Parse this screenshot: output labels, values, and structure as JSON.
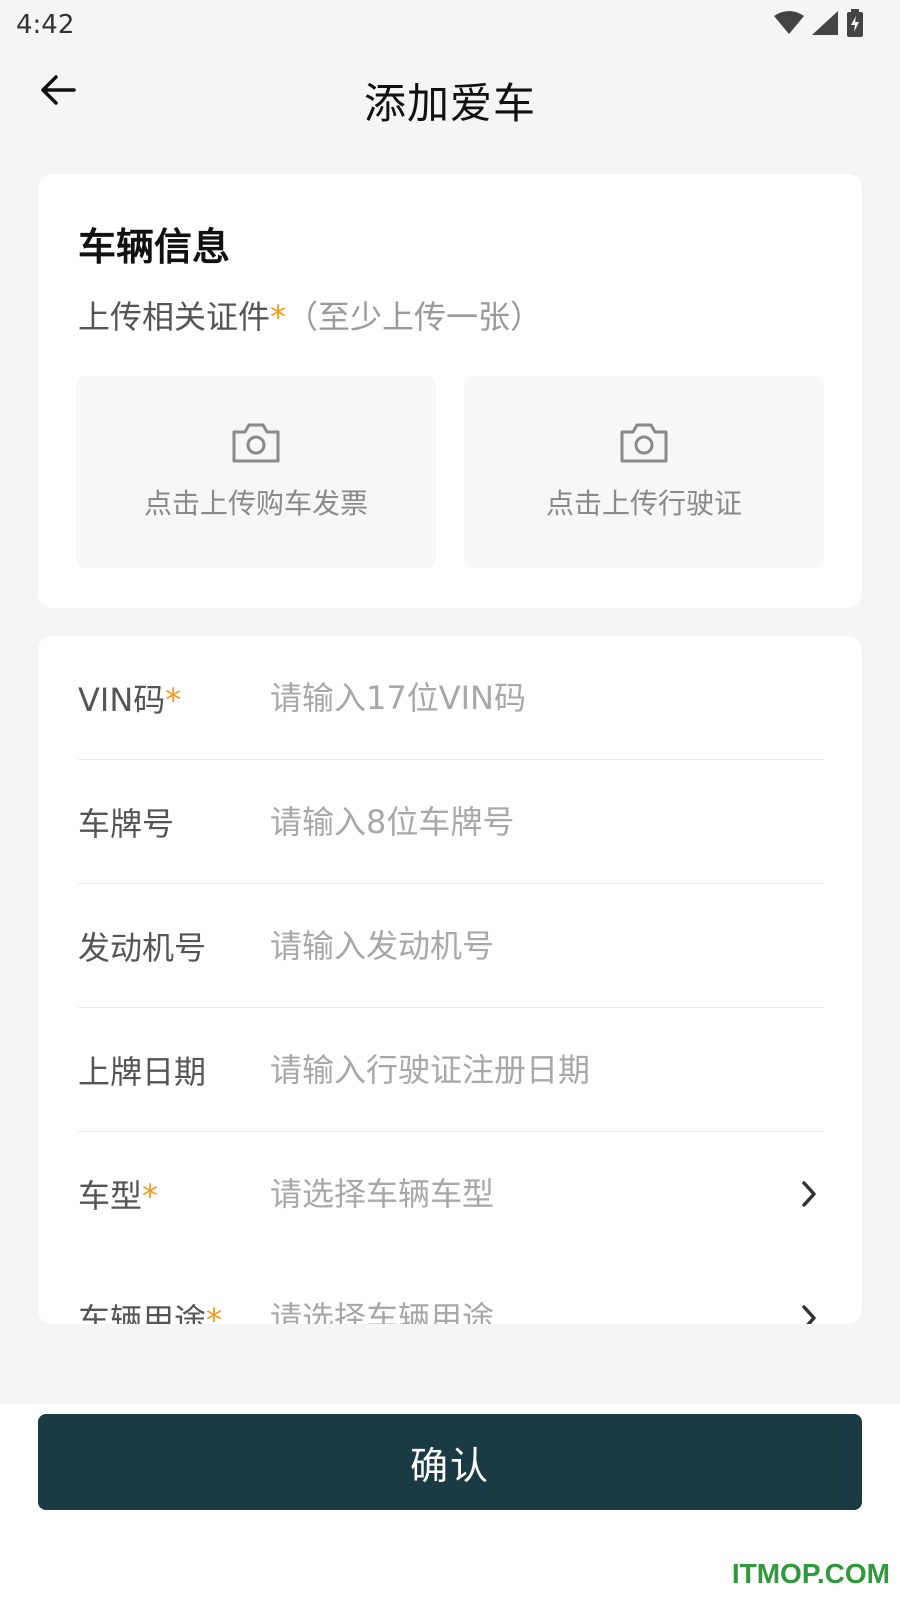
{
  "status_bar": {
    "time": "4:42",
    "icons": [
      "wifi-icon",
      "cellular-signal-icon",
      "battery-charging-icon"
    ]
  },
  "header": {
    "title": "添加爱车",
    "back_icon": "arrow-left-icon"
  },
  "vehicle_info": {
    "section_title": "车辆信息",
    "upload_label": "上传相关证件",
    "required_mark": "*",
    "upload_hint": "（至少上传一张）",
    "upload_boxes": [
      {
        "icon": "camera-icon",
        "label": "点击上传购车发票"
      },
      {
        "icon": "camera-icon",
        "label": "点击上传行驶证"
      }
    ]
  },
  "form": {
    "rows": [
      {
        "label": "VIN码",
        "required": "*",
        "placeholder": "请输入17位VIN码",
        "value": ""
      },
      {
        "label": "车牌号",
        "required": "",
        "placeholder": "请输入8位车牌号",
        "value": ""
      },
      {
        "label": "发动机号",
        "required": "",
        "placeholder": "请输入发动机号",
        "value": ""
      },
      {
        "label": "上牌日期",
        "required": "",
        "placeholder": "请输入行驶证注册日期",
        "value": ""
      },
      {
        "label": "车型",
        "required": "*",
        "placeholder": "请选择车辆车型",
        "value": "",
        "chevron": "chevron-right-icon"
      },
      {
        "label": "车辆用途",
        "required": "*",
        "placeholder": "请选择车辆用途",
        "value": "",
        "chevron": "chevron-right-icon"
      }
    ]
  },
  "footer": {
    "confirm_label": "确认"
  },
  "watermark": "ITMOP.COM",
  "colors": {
    "accent_required": "#f39a1e",
    "confirm_button": "#1a3a44",
    "background": "#f5f5f5",
    "watermark": "#2e9a3b"
  }
}
